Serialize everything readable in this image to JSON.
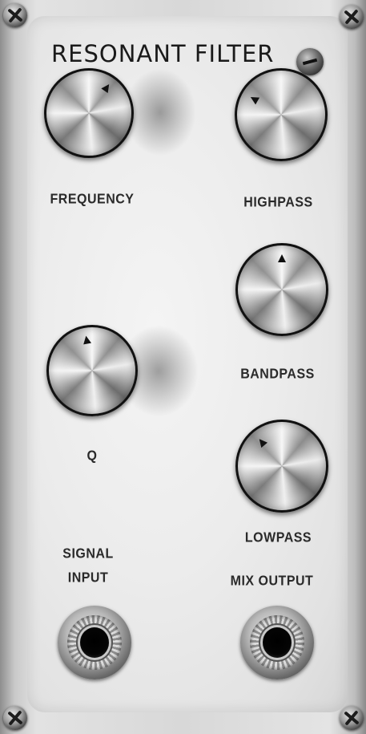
{
  "panel": {
    "title": "RESONANT FILTER",
    "labels": {
      "frequency": "FREQUENCY",
      "highpass": "HIGHPASS",
      "bandpass": "BANDPASS",
      "q": "Q",
      "lowpass": "LOWPASS",
      "signal_input_line1": "SIGNAL",
      "signal_input_line2": "INPUT",
      "mix_output": "MIX OUTPUT"
    }
  },
  "colors": {
    "panel": "#ececec",
    "frame": "#c9c9c9",
    "text": "#1a1a1a",
    "knob_border": "#111111"
  },
  "icons": {
    "knob": "brushed-metal-knob-icon",
    "jack": "audio-jack-icon",
    "screw": "screw-icon"
  }
}
